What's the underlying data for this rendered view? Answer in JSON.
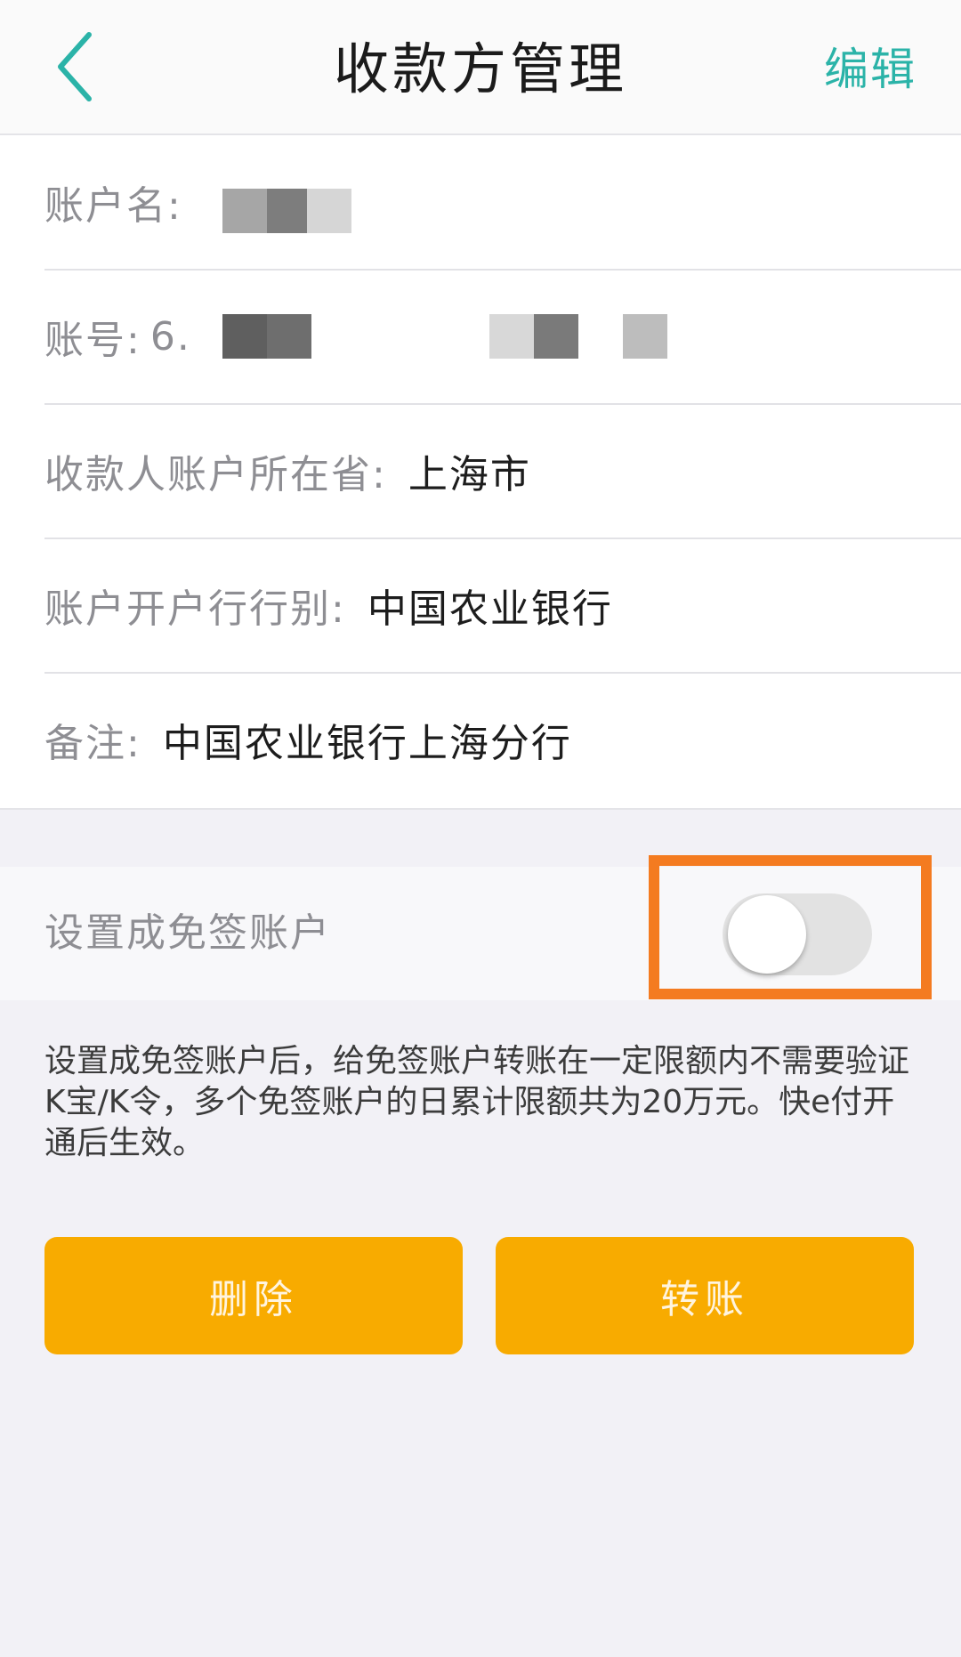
{
  "header": {
    "title": "收款方管理",
    "edit_label": "编辑"
  },
  "fields": {
    "account_name": {
      "label": "账户名:"
    },
    "account_number": {
      "label": "账号:",
      "value_prefix": "6."
    },
    "province": {
      "label": "收款人账户所在省:",
      "value": "上海市"
    },
    "bank_type": {
      "label": "账户开户行行别:",
      "value": "中国农业银行"
    },
    "remark": {
      "label": "备注:",
      "value": "中国农业银行上海分行"
    }
  },
  "sign_free": {
    "label": "设置成免签账户",
    "enabled": false,
    "note": "设置成免签账户后，给免签账户转账在一定限额内不需要验证K宝/K令，多个免签账户的日累计限额共为20万元。快e付开通后生效。"
  },
  "actions": {
    "delete_label": "删除",
    "transfer_label": "转账"
  },
  "colors": {
    "accent": "#2bb3a8",
    "button": "#f8ab00",
    "highlight": "#f47b20"
  }
}
